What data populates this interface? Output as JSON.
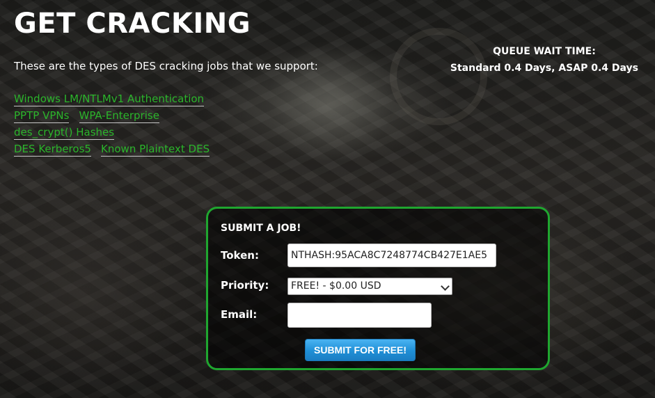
{
  "header": {
    "title": "GET CRACKING",
    "intro": "These are the types of DES cracking jobs that we support:"
  },
  "queue": {
    "label": "QUEUE WAIT TIME:",
    "times": "Standard 0.4 Days, ASAP 0.4 Days"
  },
  "job_types": [
    [
      "Windows LM/NTLMv1 Authentication"
    ],
    [
      "PPTP VPNs",
      "WPA-Enterprise"
    ],
    [
      "des_crypt() Hashes"
    ],
    [
      "DES Kerberos5",
      "Known Plaintext DES"
    ]
  ],
  "form": {
    "heading": "SUBMIT A JOB!",
    "token_label": "Token:",
    "token_value": "NTHASH:95ACA8C7248774CB427E1AE5",
    "priority_label": "Priority:",
    "priority_value": "FREE! - $0.00 USD",
    "email_label": "Email:",
    "email_value": "",
    "submit_label": "SUBMIT FOR FREE!"
  },
  "colors": {
    "link": "#2bb52b",
    "box_border": "#1fa62f",
    "button": "#1f8fd6"
  }
}
